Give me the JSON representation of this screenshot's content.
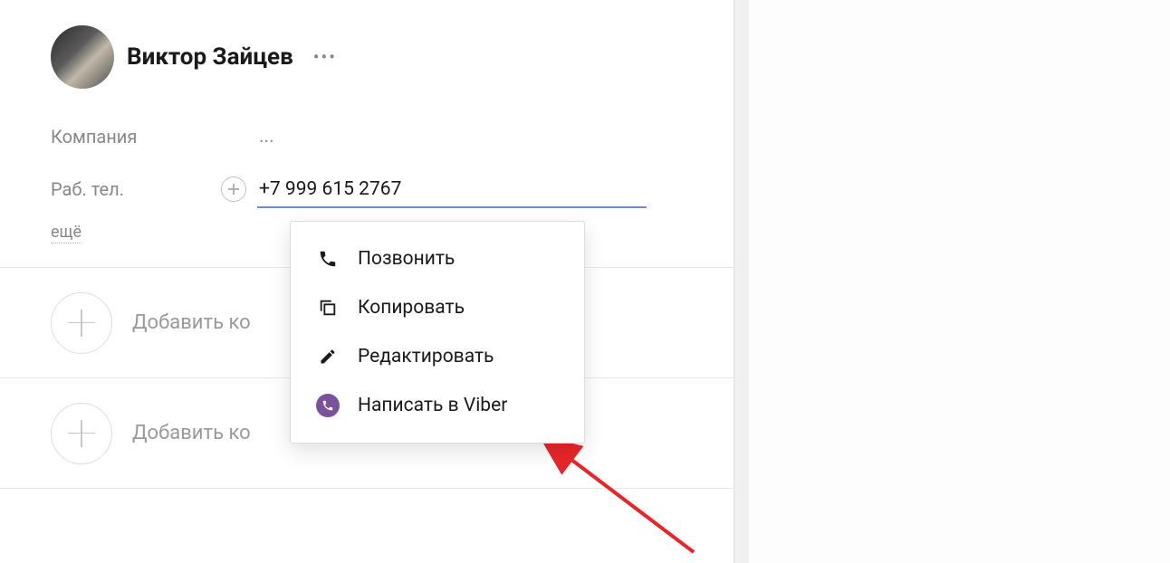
{
  "contact": {
    "name": "Виктор Зайцев"
  },
  "fields": {
    "company_label": "Компания",
    "company_value": "...",
    "phone_label": "Раб. тел.",
    "phone_value": "+7 999 615 2767"
  },
  "more_link": "ещё",
  "add": {
    "company": "Добавить ко",
    "contact": "Добавить ко"
  },
  "dropdown": {
    "call": "Позвонить",
    "copy": "Копировать",
    "edit": "Редактировать",
    "viber": "Написать в Viber"
  }
}
